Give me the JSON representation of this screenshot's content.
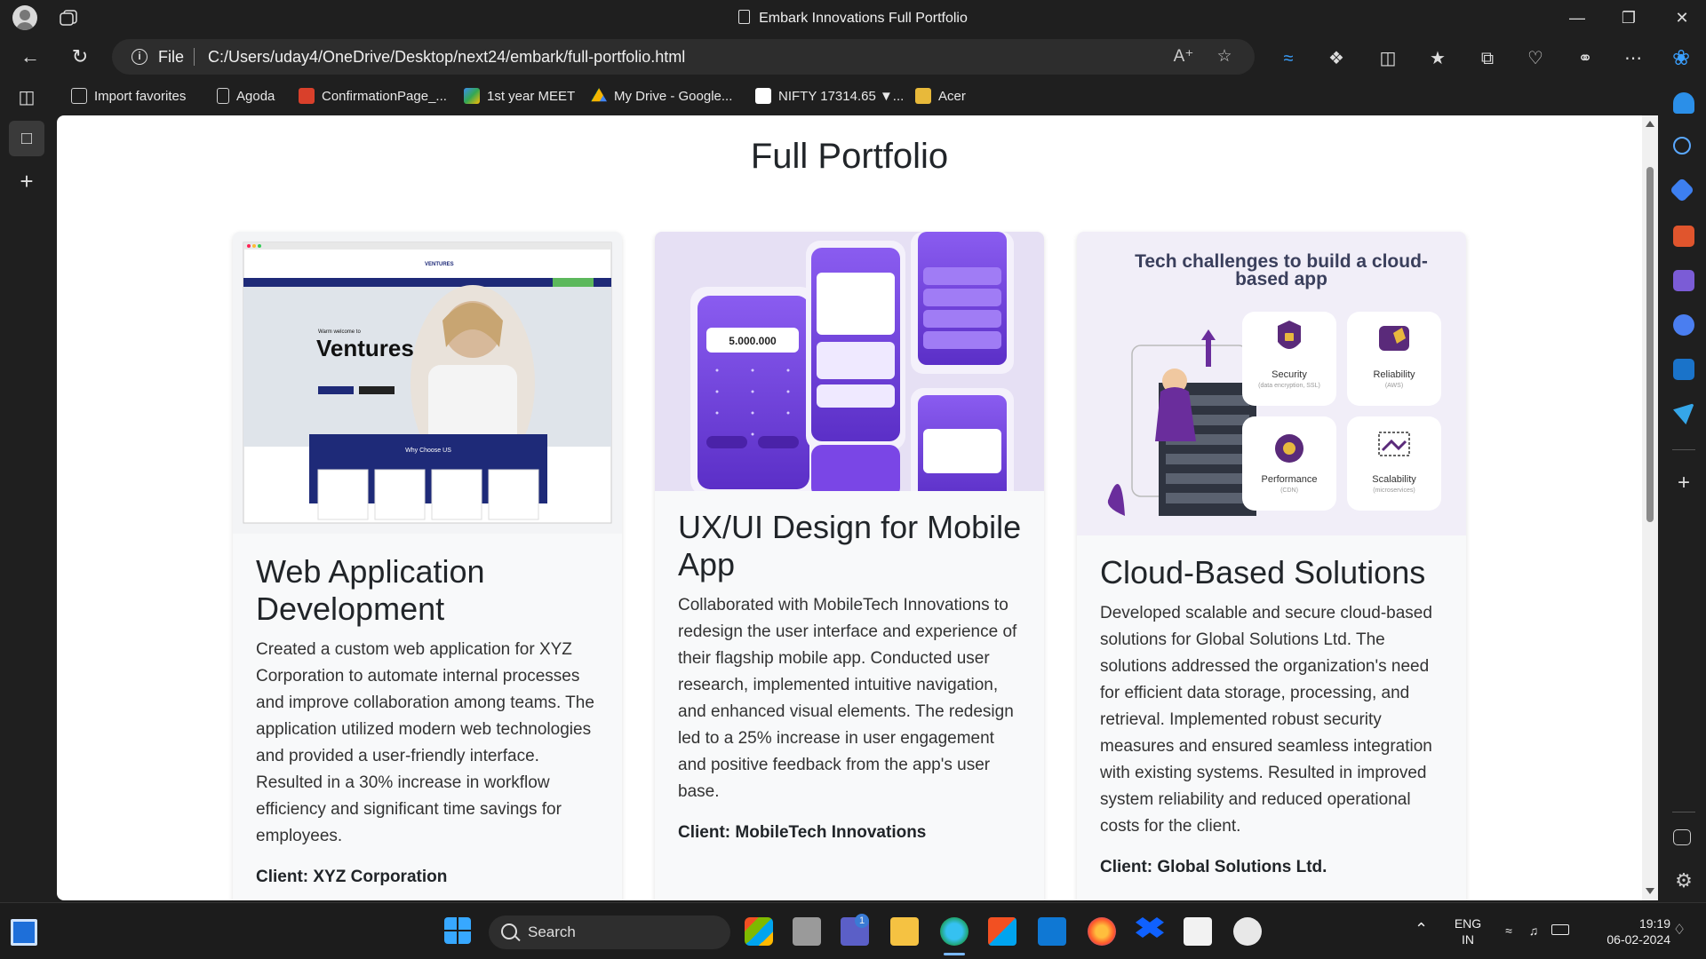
{
  "window": {
    "title": "Embark Innovations Full Portfolio"
  },
  "address_bar": {
    "scheme_label": "File",
    "url": "C:/Users/uday4/OneDrive/Desktop/next24/embark/full-portfolio.html"
  },
  "favorites": [
    {
      "label": "Import favorites",
      "color": "#cfcfcf"
    },
    {
      "label": "Agoda",
      "color": "#cfcfcf"
    },
    {
      "label": "ConfirmationPage_...",
      "color": "#d9402b"
    },
    {
      "label": "1st year MEET",
      "color": "#3b8ef0"
    },
    {
      "label": "My Drive - Google...",
      "color": "#f4b400"
    },
    {
      "label": "NIFTY 17314.65 ▼...",
      "color": "#ffffff"
    },
    {
      "label": "Acer",
      "color": "#e8b93a"
    }
  ],
  "page": {
    "title": "Full Portfolio",
    "cards": [
      {
        "title": "Web Application Development",
        "description": "Created a custom web application for XYZ Corporation to automate internal processes and improve collaboration among teams. The application utilized modern web technologies and provided a user-friendly interface. Resulted in a 30% increase in workflow efficiency and significant time savings for employees.",
        "client": "Client: XYZ Corporation",
        "image": {
          "brand": "VENTURES",
          "welcome": "Warm welcome to",
          "headline": "Ventures",
          "section": "Why Choose US"
        }
      },
      {
        "title": "UX/UI Design for Mobile App",
        "description": "Collaborated with MobileTech Innovations to redesign the user interface and experience of their flagship mobile app. Conducted user research, implemented intuitive navigation, and enhanced visual elements. The redesign led to a 25% increase in user engagement and positive feedback from the app's user base.",
        "client": "Client: MobileTech Innovations",
        "image": {
          "amount": "5.000.000"
        }
      },
      {
        "title": "Cloud-Based Solutions",
        "description": "Developed scalable and secure cloud-based solutions for Global Solutions Ltd. The solutions addressed the organization's need for efficient data storage, processing, and retrieval. Implemented robust security measures and ensured seamless integration with existing systems. Resulted in improved system reliability and reduced operational costs for the client.",
        "client": "Client: Global Solutions Ltd.",
        "image": {
          "headline": "Tech challenges to build a cloud-based app",
          "tiles": [
            {
              "label": "Security",
              "sub": "(data encryption, SSL)"
            },
            {
              "label": "Reliability",
              "sub": "(AWS)"
            },
            {
              "label": "Performance",
              "sub": "(CDN)"
            },
            {
              "label": "Scalability",
              "sub": "(microservices)"
            }
          ]
        }
      }
    ]
  },
  "taskbar": {
    "search_label": "Search",
    "language": "ENG",
    "region": "IN",
    "time": "19:19",
    "date": "06-02-2024",
    "teams_badge": "1"
  },
  "colors": {
    "accent_purple": "#7a3fd1",
    "navy": "#1e2a78",
    "edge_blue": "#2b8fe8"
  }
}
